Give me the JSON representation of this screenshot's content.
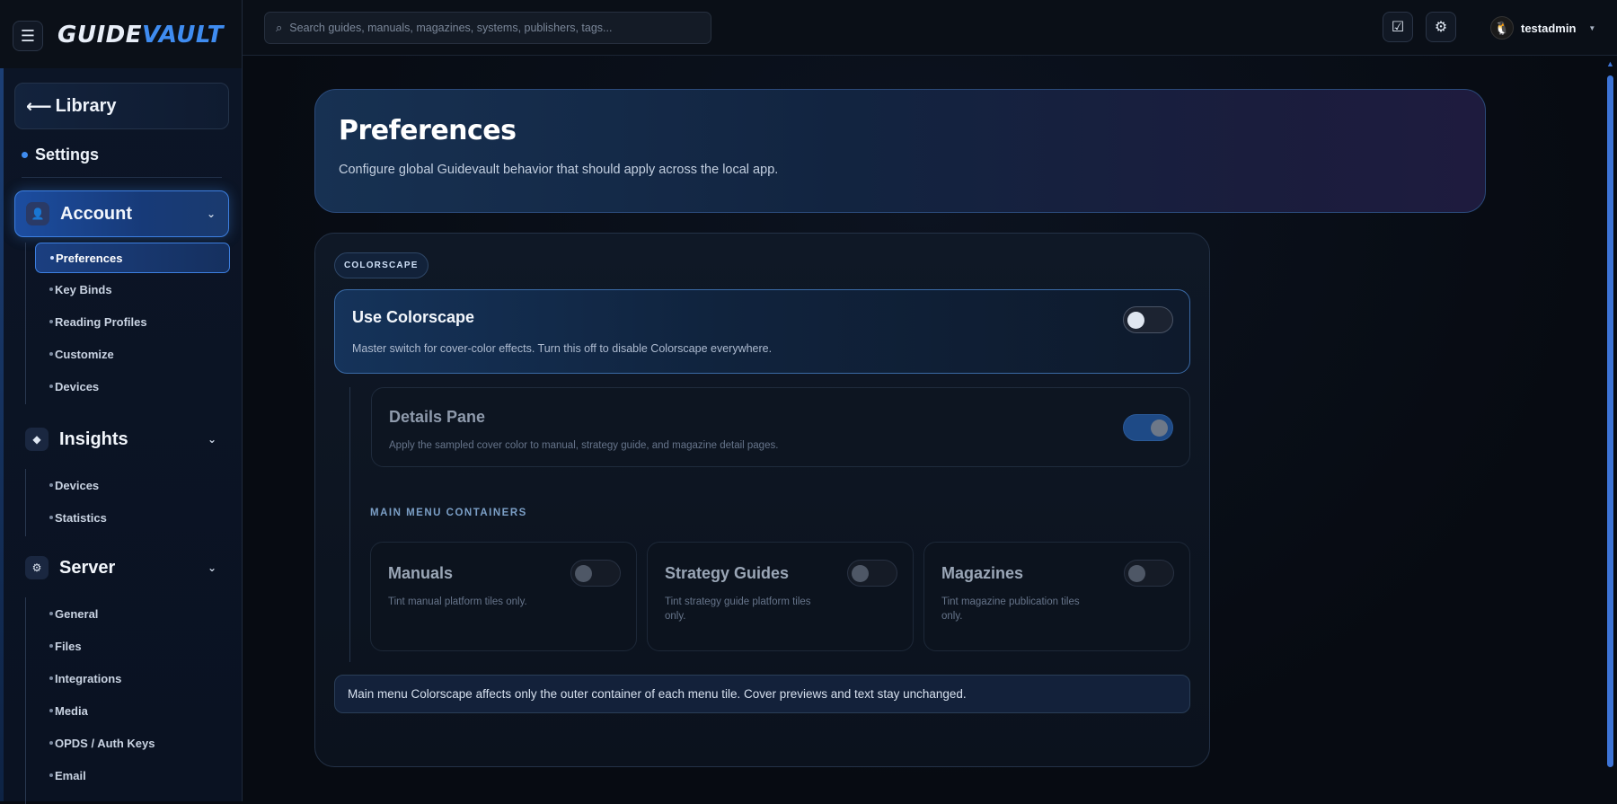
{
  "topbar": {
    "logo_part1": "GUIDE",
    "logo_part2": "VAULT",
    "search_placeholder": "Search guides, manuals, magazines, systems, publishers, tags...",
    "username": "testadmin"
  },
  "sidebar": {
    "back_label": "Library",
    "settings_label": "Settings",
    "sections": [
      {
        "label": "Account",
        "items": [
          "Preferences",
          "Key Binds",
          "Reading Profiles",
          "Customize",
          "Devices"
        ]
      },
      {
        "label": "Insights",
        "items": [
          "Devices",
          "Statistics"
        ]
      },
      {
        "label": "Server",
        "items": [
          "General",
          "Files",
          "Integrations",
          "Media",
          "OPDS / Auth Keys",
          "Email"
        ]
      }
    ]
  },
  "hero": {
    "title": "Preferences",
    "subtitle": "Configure global Guidevault behavior that should apply across the local app."
  },
  "panel": {
    "tag": "COLORSCAPE",
    "use_colorscape": {
      "title": "Use Colorscape",
      "desc": "Master switch for cover-color effects. Turn this off to disable Colorscape everywhere.",
      "enabled": false
    },
    "details_pane": {
      "title": "Details Pane",
      "desc": "Apply the sampled cover color to manual, strategy guide, and magazine detail pages.",
      "enabled": true
    },
    "section_label": "MAIN MENU CONTAINERS",
    "containers": [
      {
        "title": "Manuals",
        "desc": "Tint manual platform tiles only.",
        "enabled": false
      },
      {
        "title": "Strategy Guides",
        "desc": "Tint strategy guide platform tiles only.",
        "enabled": false
      },
      {
        "title": "Magazines",
        "desc": "Tint magazine publication tiles only.",
        "enabled": false
      }
    ],
    "note": "Main menu Colorscape affects only the outer container of each menu tile. Cover previews and text stay unchanged."
  },
  "colors": {
    "accent": "#3f8cf0",
    "background": "#070b12"
  }
}
